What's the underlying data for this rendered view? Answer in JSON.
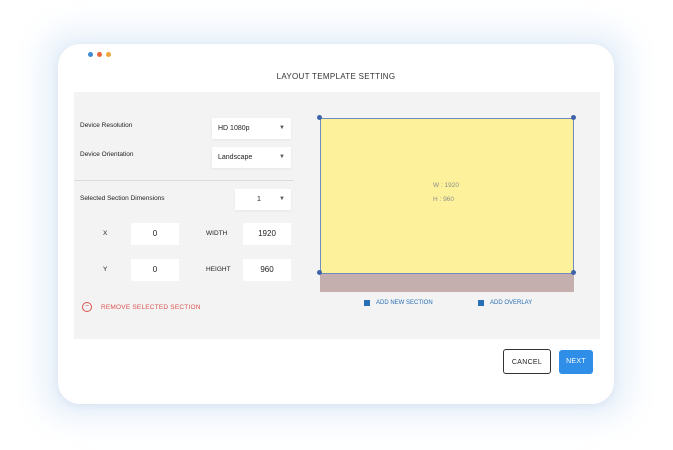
{
  "window": {
    "title": "LAYOUT TEMPLATE SETTING",
    "dots": [
      "#3d8bd4",
      "#e8673a",
      "#f0a53a"
    ]
  },
  "form": {
    "device_resolution": {
      "label": "Device Resolution",
      "value": "HD 1080p"
    },
    "device_orientation": {
      "label": "Device Orientation",
      "value": "Landscape"
    },
    "selected_section": {
      "label": "Selected Section Dimensions",
      "value": "1"
    },
    "x": {
      "label": "X",
      "value": "0"
    },
    "y": {
      "label": "Y",
      "value": "0"
    },
    "width": {
      "label": "WIDTH",
      "value": "1920"
    },
    "height": {
      "label": "HEIGHT",
      "value": "960"
    },
    "remove_label": "REMOVE SELECTED SECTION",
    "caret_icon": "chevron-down-icon"
  },
  "preview": {
    "width_text": "W : 1920",
    "height_text": "H : 960",
    "add_section_label": "ADD NEW SECTION",
    "add_overlay_label": "ADD OVERLAY",
    "section_color": "#fdf29b",
    "remaining_color": "#c5aeae",
    "handle_color": "#3f63a8"
  },
  "footer": {
    "cancel_label": "CANCEL",
    "next_label": "NEXT",
    "accent": "#2e8ee8"
  }
}
